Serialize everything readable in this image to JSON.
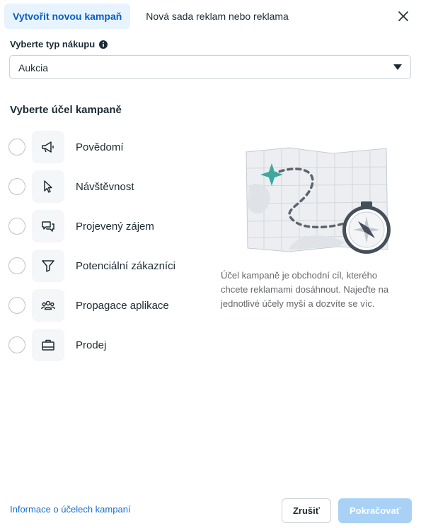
{
  "tabs": [
    {
      "label": "Vytvořit novou kampaň",
      "active": true
    },
    {
      "label": "Nová sada reklam nebo reklama",
      "active": false
    }
  ],
  "buying": {
    "label": "Vyberte typ nákupu",
    "selected": "Aukcia"
  },
  "objectives": {
    "title": "Vyberte účel kampaně",
    "items": [
      {
        "label": "Povědomí",
        "icon": "megaphone-icon"
      },
      {
        "label": "Návštěvnost",
        "icon": "cursor-icon"
      },
      {
        "label": "Projevený zájem",
        "icon": "chat-bubbles-icon"
      },
      {
        "label": "Potenciální zákazníci",
        "icon": "funnel-icon"
      },
      {
        "label": "Propagace aplikace",
        "icon": "people-icon"
      },
      {
        "label": "Prodej",
        "icon": "briefcase-icon"
      }
    ]
  },
  "description": "Účel kampaně je obchodní cíl, kterého chcete reklamami dosáhnout. Najeďte na jednotlivé účely myší a dozvíte se víc.",
  "footer": {
    "link": "Informace o účelech kampaní",
    "cancel": "Zrušiť",
    "continue": "Pokračovať"
  },
  "colors": {
    "accent": "#0a5ec2",
    "active_tab_bg": "#e7f3ff",
    "disabled_primary": "#a8d1f5",
    "link": "#1a6ec7"
  }
}
